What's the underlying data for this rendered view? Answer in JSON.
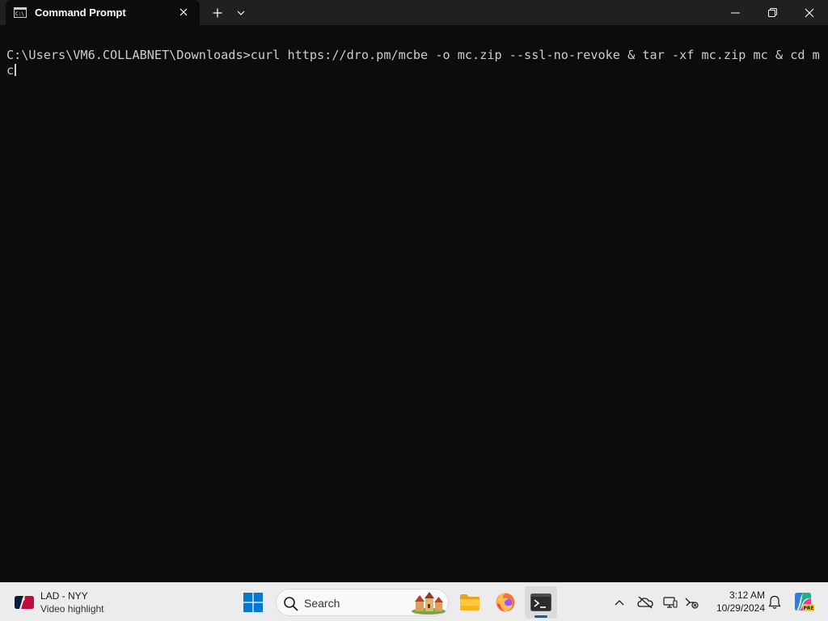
{
  "window": {
    "tab_title": "Command Prompt",
    "tab_icon": "cmd-icon"
  },
  "console": {
    "line1": "C:\\Users\\VM6.COLLABNET\\Downloads>curl https://dro.pm/mcbe -o mc.zip --ssl-no-revoke & tar -xf mc.zip mc & cd m",
    "line2": "c"
  },
  "taskbar": {
    "widget": {
      "title": "LAD - NYY",
      "subtitle": "Video highlight",
      "icon": "mlb-logo-icon"
    },
    "search_label": "Search",
    "clock": {
      "time": "3:12 AM",
      "date": "10/29/2024"
    },
    "pinned": [
      "start-icon",
      "file-explorer-icon",
      "firefox-icon",
      "terminal-icon"
    ],
    "active_app": "terminal",
    "accent_color": "#005fb8"
  }
}
